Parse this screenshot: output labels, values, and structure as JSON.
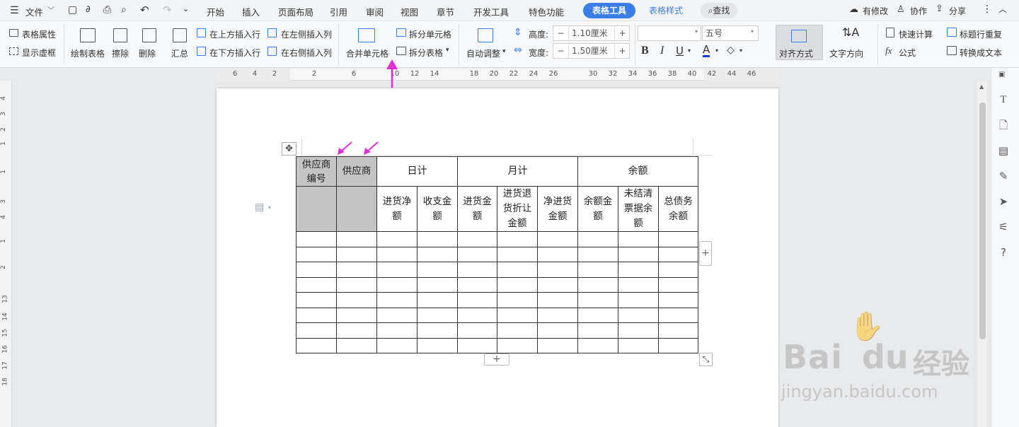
{
  "menubar": {
    "file_label": "文件",
    "tabs": [
      "开始",
      "插入",
      "页面布局",
      "引用",
      "审阅",
      "视图",
      "章节",
      "开发工具",
      "特色功能"
    ],
    "active_context_tab": "表格工具",
    "context_tab_2": "表格样式",
    "search_label": "查找",
    "modified_label": "有修改",
    "collab_label": "协作",
    "share_label": "分享"
  },
  "ribbon": {
    "table_props": "表格属性",
    "show_grid": "显示虚框",
    "draw_table": "绘制表格",
    "erase": "擦除",
    "delete": "删除",
    "summary": "汇总",
    "insert_above": "在上方插入行",
    "insert_below": "在下方插入行",
    "insert_left": "在左侧插入列",
    "insert_right": "在右侧插入列",
    "merge_cells": "合并单元格",
    "split_cells": "拆分单元格",
    "split_table": "拆分表格",
    "auto_adjust": "自动调整",
    "height_label": "高度:",
    "height_value": "1.10厘米",
    "width_label": "宽度:",
    "width_value": "1.50厘米",
    "font_name": "",
    "font_size": "五号",
    "align": "对齐方式",
    "text_dir": "文字方向",
    "quick_calc": "快速计算",
    "formula": "公式",
    "title_repeat": "标题行重复",
    "to_text": "转换成文本"
  },
  "ruler_numbers": [
    "6",
    "4",
    "2",
    "2",
    "6",
    "10",
    "12",
    "14",
    "18",
    "20",
    "22",
    "24",
    "26",
    "30",
    "32",
    "34",
    "36",
    "38",
    "40",
    "42",
    "44",
    "46"
  ],
  "vruler_numbers": [
    "4",
    "3",
    "2",
    "1",
    "1",
    "3",
    "4",
    "1",
    "2",
    "13",
    "14",
    "15",
    "16",
    "17",
    "18"
  ],
  "table": {
    "header1": [
      "供应商编号",
      "供应商",
      "日计",
      "月计",
      "余额"
    ],
    "header2": [
      "进货净额",
      "收支金额",
      "进货金额",
      "进货退货折让金额",
      "净进货金额",
      "余额金额",
      "未结清票据余额",
      "总债务余额"
    ],
    "empty_rows": 8
  },
  "watermark": {
    "brand": "Bai",
    "suffix": "du",
    "site": "经验",
    "url": "jingyan.baidu.com"
  },
  "colors": {
    "accent": "#3b7ee8",
    "arrow": "#e22fd5",
    "selected_cell": "#c4c4c4"
  }
}
